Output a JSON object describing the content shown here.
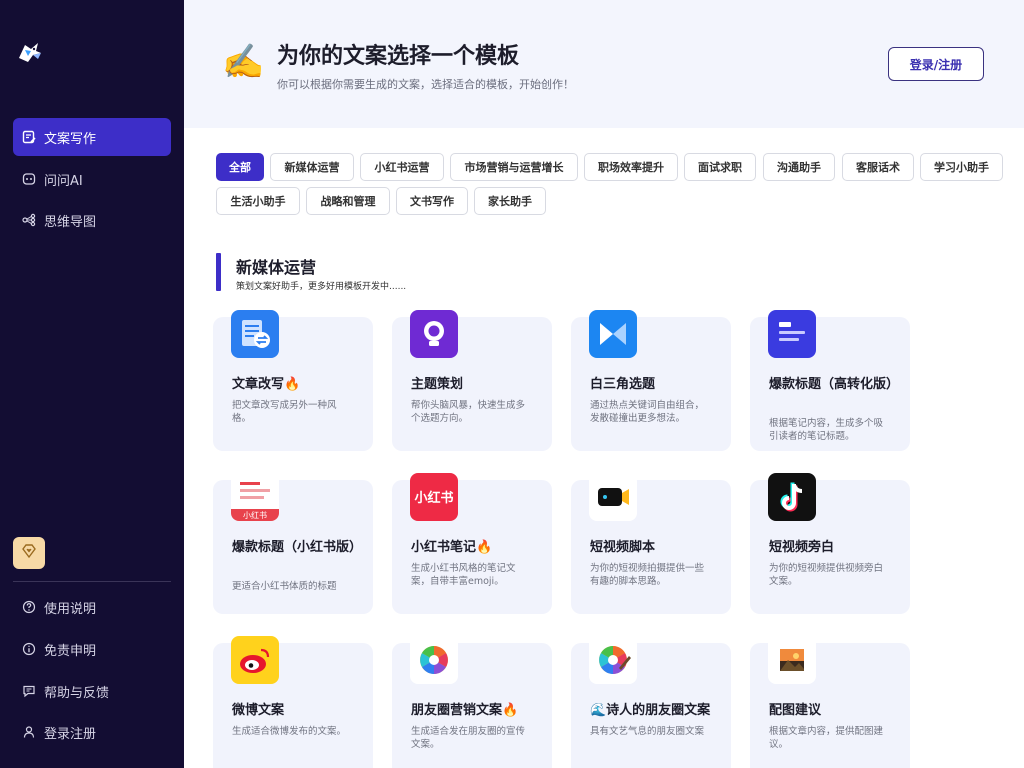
{
  "sidebar": {
    "logo": "shark-logo",
    "nav": [
      {
        "label": "文案写作",
        "icon": "document-edit-icon",
        "active": true
      },
      {
        "label": "问问AI",
        "icon": "ai-chat-icon",
        "active": false
      },
      {
        "label": "思维导图",
        "icon": "mindmap-icon",
        "active": false
      }
    ],
    "vip_icon": "diamond-heart-icon",
    "bottom": [
      {
        "label": "使用说明",
        "icon": "help-circle-icon"
      },
      {
        "label": "免责申明",
        "icon": "info-circle-icon"
      },
      {
        "label": "帮助与反馈",
        "icon": "feedback-icon"
      },
      {
        "label": "登录注册",
        "icon": "user-icon"
      }
    ]
  },
  "header": {
    "emoji": "✍️",
    "title": "为你的文案选择一个模板",
    "subtitle": "你可以根据你需要生成的文案，选择适合的模板，开始创作！",
    "login_label": "登录/注册"
  },
  "filters": [
    {
      "label": "全部",
      "active": true
    },
    {
      "label": "新媒体运营",
      "active": false
    },
    {
      "label": "小红书运营",
      "active": false
    },
    {
      "label": "市场营销与运营增长",
      "active": false
    },
    {
      "label": "职场效率提升",
      "active": false
    },
    {
      "label": "面试求职",
      "active": false
    },
    {
      "label": "沟通助手",
      "active": false
    },
    {
      "label": "客服话术",
      "active": false
    },
    {
      "label": "学习小助手",
      "active": false
    },
    {
      "label": "生活小助手",
      "active": false
    },
    {
      "label": "战略和管理",
      "active": false
    },
    {
      "label": "文书写作",
      "active": false
    },
    {
      "label": "家长助手",
      "active": false
    }
  ],
  "section": {
    "title": "新媒体运营",
    "subtitle": "策划文案好助手，更多好用模板开发中......"
  },
  "cards": [
    {
      "title": "文章改写🔥",
      "desc": "把文章改写成另外一种风格。",
      "icon": "article-rewrite-icon"
    },
    {
      "title": "主题策划",
      "desc": "帮你头脑风暴，快速生成多个选题方向。",
      "icon": "lightbulb-icon"
    },
    {
      "title": "白三角选题",
      "desc": "通过热点关键词自由组合，发散碰撞出更多想法。",
      "icon": "triangle-icon"
    },
    {
      "title": "爆款标题（高转化版）",
      "desc": "根据笔记内容，生成多个吸引读者的笔记标题。",
      "icon": "headline-icon"
    },
    {
      "title": "爆款标题（小红书版）",
      "desc": "更适合小红书体质的标题",
      "icon": "xiaohongshu-title-icon",
      "icon_caption": "小红书"
    },
    {
      "title": "小红书笔记🔥",
      "desc": "生成小红书风格的笔记文案，自带丰富emoji。",
      "icon": "xiaohongshu-logo-icon",
      "icon_caption": "小红书"
    },
    {
      "title": "短视频脚本",
      "desc": "为你的短视频拍摄提供一些有趣的脚本思路。",
      "icon": "video-camera-icon"
    },
    {
      "title": "短视频旁白",
      "desc": "为你的短视频提供视频旁白文案。",
      "icon": "tiktok-icon"
    },
    {
      "title": "微博文案",
      "desc": "生成适合微博发布的文案。",
      "icon": "weibo-icon"
    },
    {
      "title": "朋友圈营销文案🔥",
      "desc": "生成适合发在朋友圈的宣传文案。",
      "icon": "moments-icon"
    },
    {
      "title": "🌊诗人的朋友圈文案",
      "desc": "具有文艺气息的朋友圈文案",
      "icon": "moments-poet-icon"
    },
    {
      "title": "配图建议",
      "desc": "根据文章内容，提供配图建议。",
      "icon": "image-icon"
    }
  ]
}
